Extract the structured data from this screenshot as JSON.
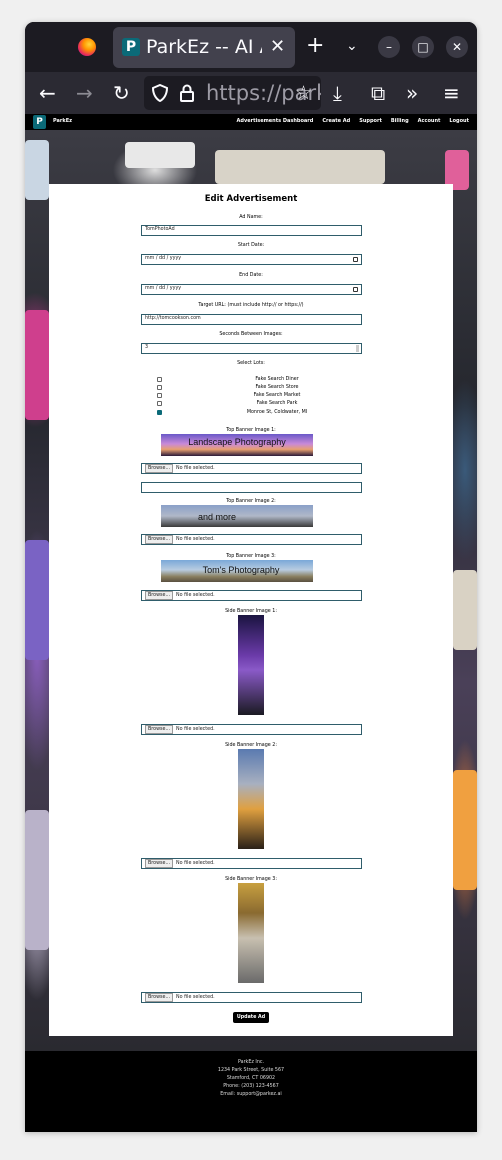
{
  "browser": {
    "tab_title": "ParkEz -- AI Assistant",
    "tab_favicon": "P",
    "url": "https://parkez.ai",
    "icons": [
      "firefox-icon",
      "plus-icon",
      "chevron-down-icon",
      "minimize-icon",
      "maximize-icon",
      "close-icon",
      "back-icon",
      "forward-icon",
      "reload-icon",
      "shield-icon",
      "lock-icon",
      "star-icon",
      "download-icon",
      "extensions-icon",
      "overflow-icon",
      "menu-icon"
    ]
  },
  "site": {
    "brand": "ParkEz",
    "logo_letter": "P",
    "nav": [
      "Advertisements Dashboard",
      "Create Ad",
      "Support",
      "Billing",
      "Account",
      "Logout"
    ],
    "accent": "#0b6a78"
  },
  "form": {
    "title": "Edit Advertisement",
    "ad_name_label": "Ad Name:",
    "ad_name_value": "TomPhotoAd",
    "start_date_label": "Start Date:",
    "start_date_value": "mm / dd / yyyy",
    "end_date_label": "End Date:",
    "end_date_value": "mm / dd / yyyy",
    "target_url_label": "Target URL: (must include http:// or https://)",
    "target_url_value": "http://tomcookson.com",
    "seconds_label": "Seconds Between Images:",
    "seconds_value": "3",
    "lots_label": "Select Lots:",
    "lots": [
      {
        "name": "Fake Search Diner",
        "checked": false
      },
      {
        "name": "Fake Search Store",
        "checked": false
      },
      {
        "name": "Fake Search Market",
        "checked": false
      },
      {
        "name": "Fake Search Park",
        "checked": false
      },
      {
        "name": "Monroe St, Coldwater, MI",
        "checked": true
      }
    ],
    "browse_label": "Browse...",
    "no_file_text": "No file selected.",
    "top_banner_1_label": "Top Banner Image 1:",
    "top_banner_1_caption": "Landscape Photography",
    "top_banner_2_label": "Top Banner Image 2:",
    "top_banner_2_caption": "and more",
    "top_banner_3_label": "Top Banner Image 3:",
    "top_banner_3_caption": "Tom's Photography",
    "side_banner_1_label": "Side Banner Image 1:",
    "side_banner_2_label": "Side Banner Image 2:",
    "side_banner_3_label": "Side Banner Image 3:",
    "submit_label": "Update Ad"
  },
  "footer": {
    "lines": [
      "ParkEz Inc.",
      "1234 Park Street, Suite 567",
      "Stamford, CT 06902",
      "Phone: (203) 123-4567",
      "Email: support@parkez.ai"
    ]
  }
}
